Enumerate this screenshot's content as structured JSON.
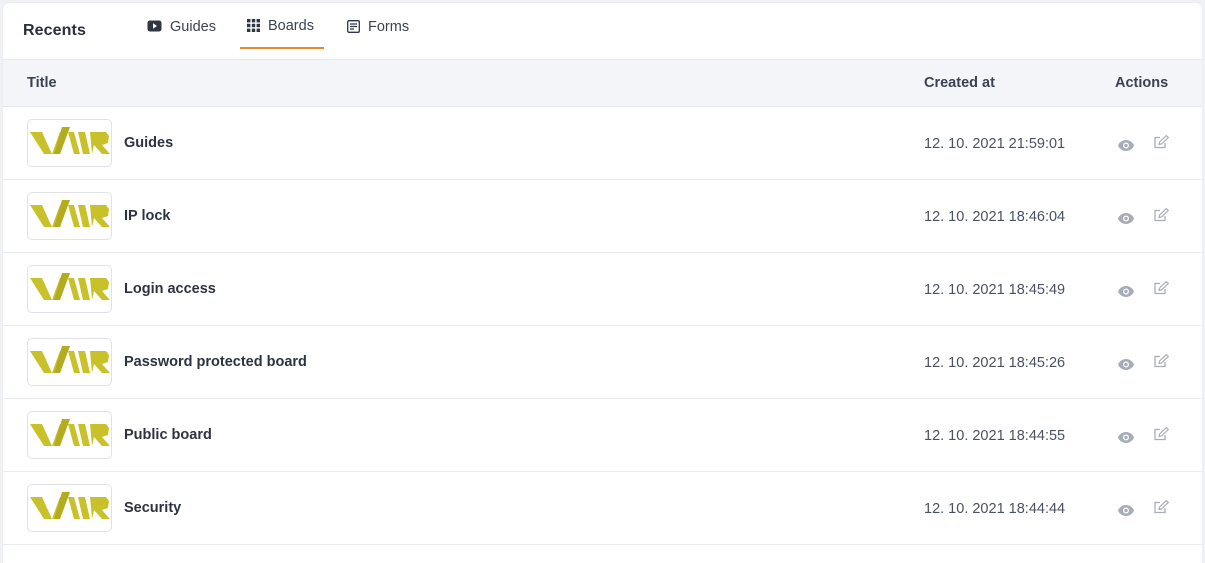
{
  "header": {
    "title": "Recents",
    "tabs": [
      {
        "label": "Guides",
        "icon": "video-icon",
        "active": false
      },
      {
        "label": "Boards",
        "icon": "grid-icon",
        "active": true
      },
      {
        "label": "Forms",
        "icon": "form-icon",
        "active": false
      }
    ]
  },
  "table": {
    "columns": {
      "title": "Title",
      "created": "Created at",
      "actions": "Actions"
    },
    "rows": [
      {
        "title": "Guides",
        "created": "12. 10. 2021 21:59:01"
      },
      {
        "title": "IP lock",
        "created": "12. 10. 2021 18:46:04"
      },
      {
        "title": "Login access",
        "created": "12. 10. 2021 18:45:49"
      },
      {
        "title": "Password protected board",
        "created": "12. 10. 2021 18:45:26"
      },
      {
        "title": "Public board",
        "created": "12. 10. 2021 18:44:55"
      },
      {
        "title": "Security",
        "created": "12. 10. 2021 18:44:44"
      }
    ]
  },
  "colors": {
    "accent": "#e88a2c",
    "logo": "#c9c12a",
    "icon": "#a7adb8"
  }
}
